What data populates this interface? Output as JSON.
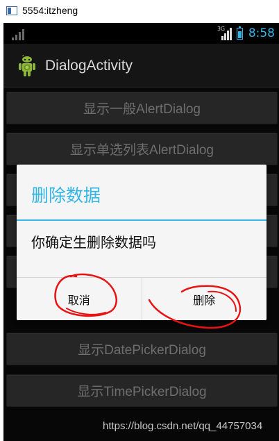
{
  "window": {
    "title": "5554:itzheng"
  },
  "statusbar": {
    "network": "3G",
    "time": "8:58",
    "colors": {
      "accent": "#33b5e5"
    }
  },
  "actionbar": {
    "title": "DialogActivity",
    "icon": "android-robot-icon"
  },
  "buttons": [
    {
      "label": "显示一般AlertDialog"
    },
    {
      "label": "显示单选列表AlertDialog"
    },
    {
      "label": ""
    },
    {
      "label": ""
    },
    {
      "label": ""
    },
    {
      "label": "显示DatePickerDialog"
    },
    {
      "label": "显示TimePickerDialog"
    }
  ],
  "dialog": {
    "title": "删除数据",
    "message": "你确定生删除数据吗",
    "negative": "取消",
    "positive": "删除"
  },
  "watermark": "https://blog.csdn.net/qq_44757034",
  "annotations": {
    "color": "#e81212"
  }
}
